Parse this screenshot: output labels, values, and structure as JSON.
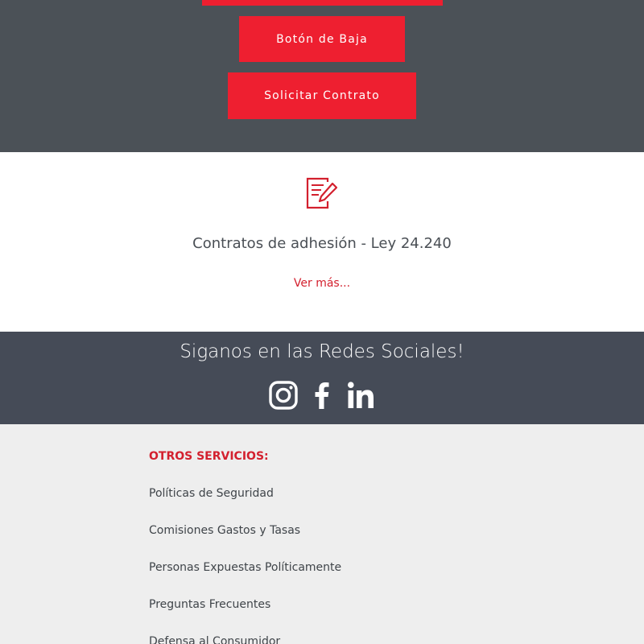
{
  "actions": {
    "baja_label": "Botón de Baja",
    "contrato_label": "Solicitar Contrato"
  },
  "contracts": {
    "title": "Contratos de adhesión - Ley 24.240",
    "link_label": "Ver más..."
  },
  "social": {
    "title": "Siganos en las Redes Sociales!",
    "icons": [
      "instagram-icon",
      "facebook-icon",
      "linkedin-icon"
    ]
  },
  "footer": {
    "heading": "OTROS SERVICIOS:",
    "links": [
      "Políticas de Seguridad",
      "Comisiones Gastos y Tasas",
      "Personas Expuestas Políticamente",
      "Preguntas Frecuentes",
      "Defensa al Consumidor"
    ]
  },
  "colors": {
    "accent": "#ee1f30",
    "top_band": "#4b5157",
    "social_band": "#454b57",
    "footer_bg": "#eeeeee"
  }
}
